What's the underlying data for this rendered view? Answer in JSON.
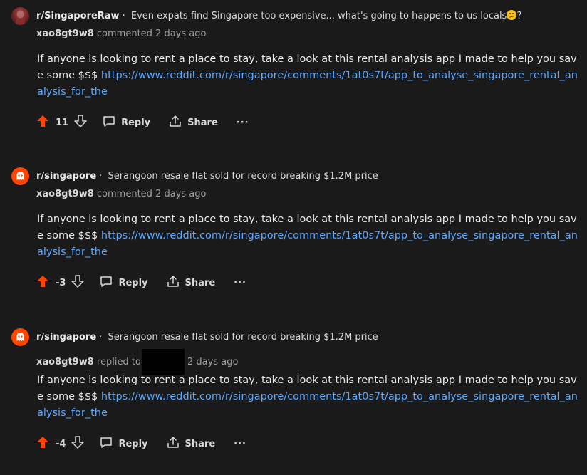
{
  "comments": [
    {
      "subreddit": "r/SingaporeRaw",
      "post_title": "Even expats find Singapore too expensive... what's going to happens to us locals",
      "post_title_suffix": "?",
      "author": "xao8gt9w8",
      "action": "commented",
      "time": "2 days ago",
      "body_text": "If anyone is looking to rent a place to stay, take a look at this rental analysis app I made to help you save some $$$ ",
      "link": "https://www.reddit.com/r/singapore/comments/1at0s7t/app_to_analyse_singapore_rental_analysis_for_the",
      "score": "11",
      "reply_label": "Reply",
      "share_label": "Share",
      "more_label": "···",
      "avatar_icon": "subreddit-avatar-icon"
    },
    {
      "subreddit": "r/singapore",
      "post_title": "Serangoon resale flat sold for record breaking $1.2M price",
      "author": "xao8gt9w8",
      "action": "commented",
      "time": "2 days ago",
      "body_text": "If anyone is looking to rent a place to stay, take a look at this rental analysis app I made to help you save some $$$ ",
      "link": "https://www.reddit.com/r/singapore/comments/1at0s7t/app_to_analyse_singapore_rental_analysis_for_the",
      "score": "-3",
      "reply_label": "Reply",
      "share_label": "Share",
      "more_label": "···",
      "avatar_icon": "reddit-snoo-icon"
    },
    {
      "subreddit": "r/singapore",
      "post_title": "Serangoon resale flat sold for record breaking $1.2M price",
      "author": "xao8gt9w8",
      "action": "replied to",
      "time": "2 days ago",
      "body_text": "If anyone is looking to rent a place to stay, take a look at this rental analysis app I made to help you save some $$$ ",
      "link": "https://www.reddit.com/r/singapore/comments/1at0s7t/app_to_analyse_singapore_rental_analysis_for_the",
      "score": "-4",
      "reply_label": "Reply",
      "share_label": "Share",
      "more_label": "···",
      "avatar_icon": "reddit-snoo-icon"
    }
  ],
  "colors": {
    "background": "#1a1a1b",
    "upvote": "#ff4500",
    "link": "#5ba8ff",
    "muted": "#9aa0a3"
  }
}
